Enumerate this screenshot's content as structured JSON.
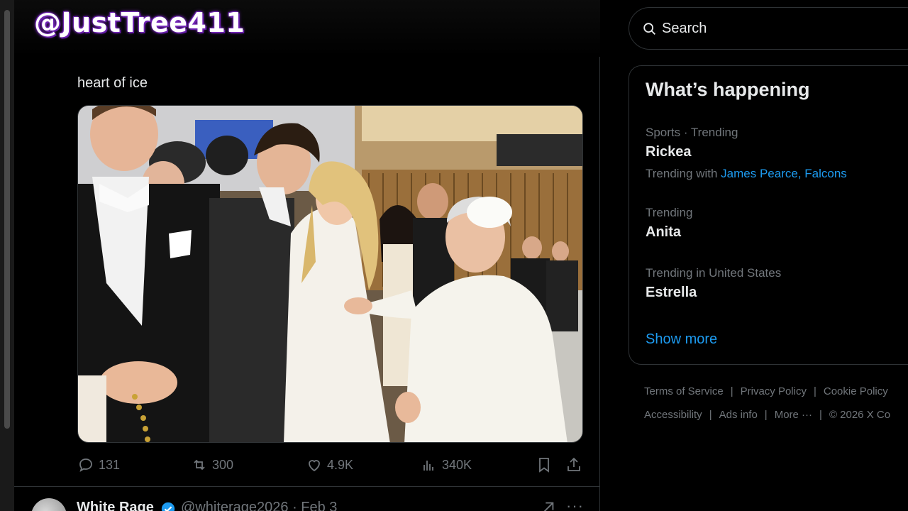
{
  "watermark": "@JustTree411",
  "tweet": {
    "text": "heart of ice",
    "stats": {
      "replies": "131",
      "reposts": "300",
      "likes": "4.9K",
      "views": "340K"
    }
  },
  "next_tweet": {
    "name": "White Rage",
    "handle_date": "@whiterage2026 · Feb 3"
  },
  "sidebar": {
    "search_placeholder": "Search",
    "trends_title": "What’s happening",
    "trends": [
      {
        "meta": "Sports · Trending",
        "name": "Rickea",
        "with_label": "Trending with",
        "with_links": "James Pearce, Falcons"
      },
      {
        "meta": "Trending",
        "name": "Anita"
      },
      {
        "meta": "Trending in United States",
        "name": "Estrella"
      }
    ],
    "show_more": "Show more",
    "footer": {
      "terms": "Terms of Service",
      "privacy": "Privacy Policy",
      "cookie": "Cookie Policy",
      "accessibility": "Accessibility",
      "ads": "Ads info",
      "more": "More ···",
      "copyright": "© 2026 X Co"
    }
  },
  "colors": {
    "background": "#000000",
    "text": "#e7e9ea",
    "muted": "#71767b",
    "accent": "#1d9bf0",
    "border": "#2f3336"
  },
  "icons": [
    "reply-icon",
    "repost-icon",
    "like-icon",
    "views-icon",
    "bookmark-icon",
    "share-icon",
    "search-icon",
    "verified-icon",
    "grok-icon",
    "more-icon"
  ]
}
